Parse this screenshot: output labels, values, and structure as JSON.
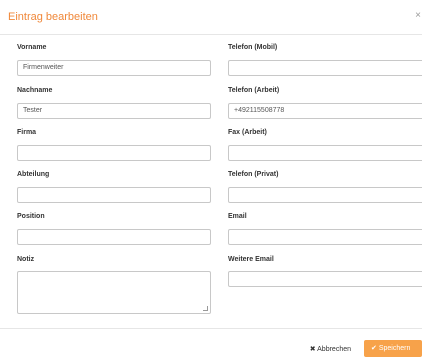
{
  "dialog": {
    "title": "Eintrag bearbeiten",
    "close_glyph": "×"
  },
  "fields": {
    "vorname": {
      "label": "Vorname",
      "value": "Firmenweiter"
    },
    "nachname": {
      "label": "Nachname",
      "value": "Tester"
    },
    "firma": {
      "label": "Firma",
      "value": ""
    },
    "abteilung": {
      "label": "Abteilung",
      "value": ""
    },
    "position": {
      "label": "Position",
      "value": ""
    },
    "notiz": {
      "label": "Notiz",
      "value": ""
    },
    "telefon_mobil": {
      "label": "Telefon (Mobil)",
      "value": ""
    },
    "telefon_arbeit": {
      "label": "Telefon (Arbeit)",
      "value": "+492115508778"
    },
    "fax_arbeit": {
      "label": "Fax (Arbeit)",
      "value": ""
    },
    "telefon_privat": {
      "label": "Telefon (Privat)",
      "value": ""
    },
    "email": {
      "label": "Email",
      "value": ""
    },
    "weitere_email": {
      "label": "Weitere Email",
      "value": ""
    }
  },
  "footer": {
    "cancel_label": "Abbrechen",
    "cancel_glyph": "✖",
    "save_label": "Speichern",
    "save_glyph": "✔"
  },
  "colors": {
    "accent": "#f0883a",
    "save_button": "#f7a24a"
  }
}
